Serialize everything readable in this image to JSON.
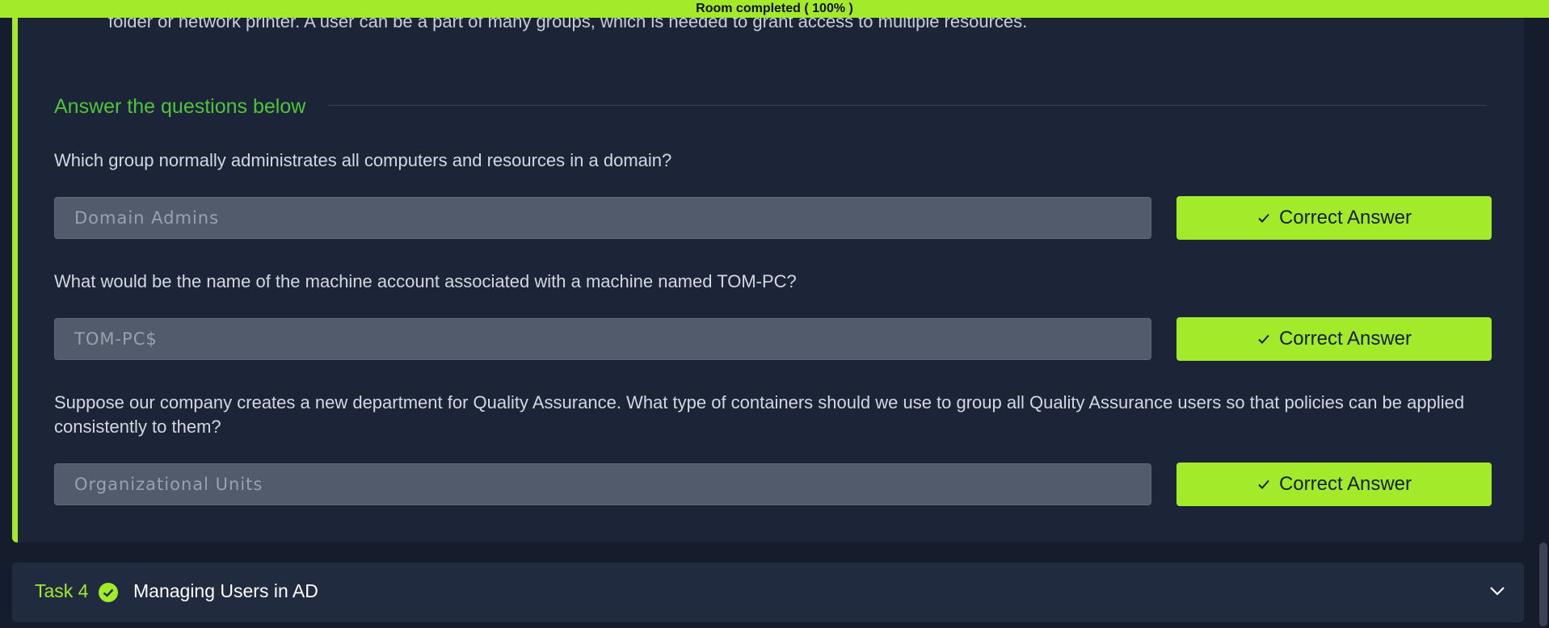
{
  "status_bar": {
    "text": "Room completed ( 100% )",
    "progress": 100
  },
  "task3": {
    "previous_text": "folder or network printer. A user can be a part of many groups, which is needed to grant access to multiple resources.",
    "answer_heading": "Answer the questions below",
    "questions": [
      {
        "question": "Which group normally administrates all computers and resources in a domain?",
        "answer": "Domain Admins",
        "button_label": "Correct Answer"
      },
      {
        "question": "What would be the name of the machine account associated with a machine named TOM-PC?",
        "answer": "TOM-PC$",
        "button_label": "Correct Answer"
      },
      {
        "question": "Suppose our company creates a new department for Quality Assurance. What type of containers should we use to group all Quality Assurance users so that policies can be applied consistently to them?",
        "answer": "Organizational Units",
        "button_label": "Correct Answer"
      }
    ]
  },
  "task4": {
    "number_label": "Task 4",
    "title": "Managing Users in AD",
    "completed": true,
    "icons": [
      "check-circle-icon",
      "chevron-down-icon"
    ]
  },
  "colors": {
    "accent": "#a3ea2a",
    "heading_green": "#4ec33b",
    "card_bg": "#1c2538",
    "page_bg": "#151c2b",
    "field_bg": "#525b6c"
  }
}
